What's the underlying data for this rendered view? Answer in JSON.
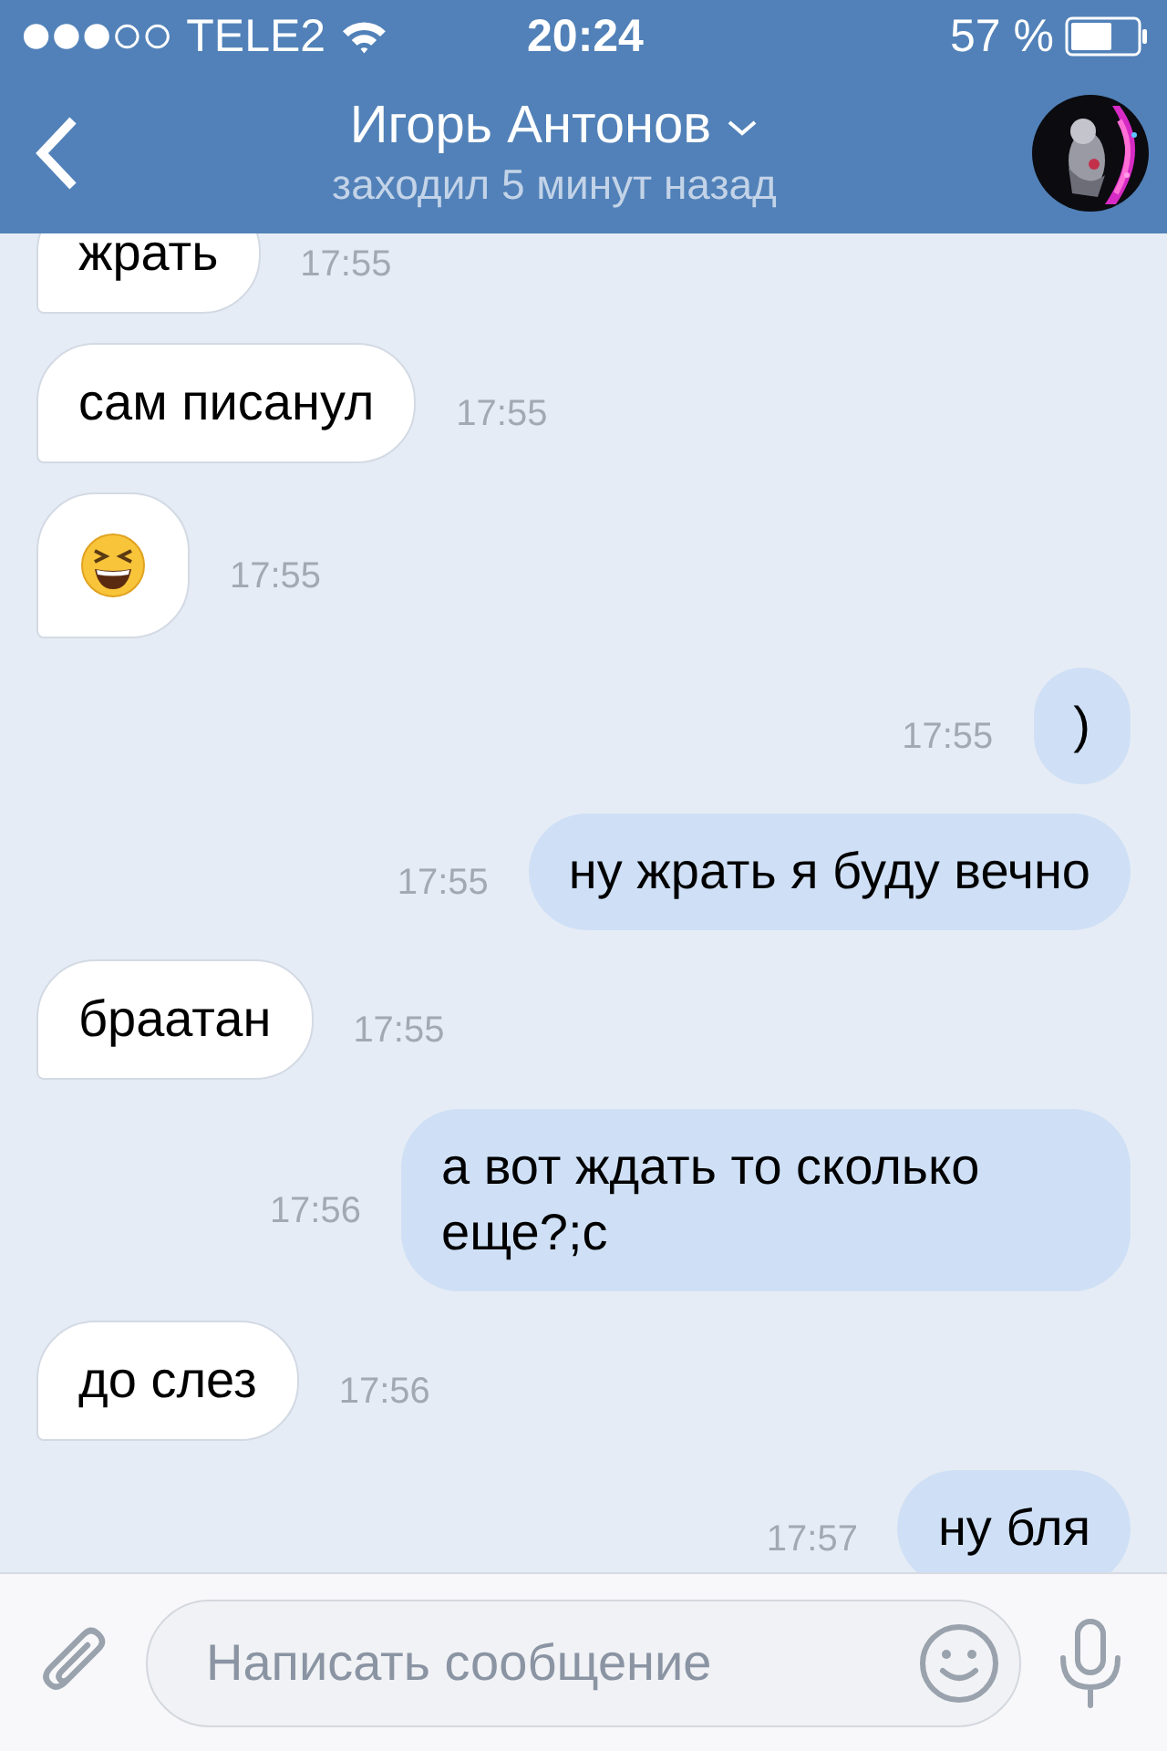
{
  "status_bar": {
    "carrier": "TELE2",
    "time": "20:24",
    "battery": "57 %"
  },
  "header": {
    "title": "Игорь Антонов",
    "subtitle": "заходил 5 минут назад"
  },
  "messages": [
    {
      "outgoing": false,
      "kind": "text",
      "text": "жрать",
      "time": "17:55"
    },
    {
      "outgoing": false,
      "kind": "text",
      "text": "сам писанул",
      "time": "17:55"
    },
    {
      "outgoing": false,
      "kind": "emoji",
      "time": "17:55"
    },
    {
      "outgoing": true,
      "kind": "text",
      "text": ")",
      "time": "17:55"
    },
    {
      "outgoing": true,
      "kind": "text",
      "text": "ну жрать я буду вечно",
      "time": "17:55"
    },
    {
      "outgoing": false,
      "kind": "text",
      "text": "браатан",
      "time": "17:55"
    },
    {
      "outgoing": true,
      "kind": "text",
      "text": "а вот ждать то сколько еще?;с",
      "time": "17:56"
    },
    {
      "outgoing": false,
      "kind": "text",
      "text": "до слез",
      "time": "17:56"
    },
    {
      "outgoing": true,
      "kind": "text",
      "text": "ну бля",
      "time": "17:57"
    }
  ],
  "composer": {
    "placeholder": "Написать сообщение"
  }
}
